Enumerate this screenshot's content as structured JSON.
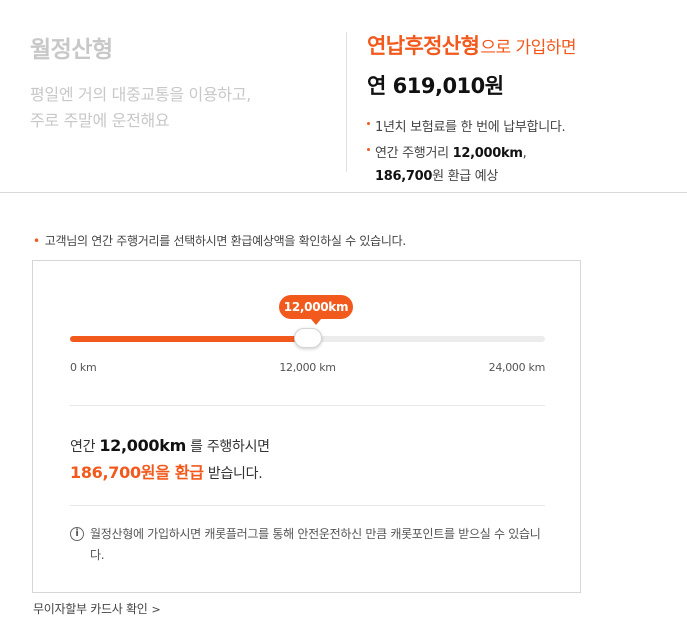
{
  "plan_left": {
    "name": "월정산형",
    "desc_line1": "평일엔 거의 대중교통을 이용하고,",
    "desc_line2": "주로 주말에 운전해요"
  },
  "plan_right": {
    "headline_emph": "연납후정산형",
    "headline_suffix": "으로 가입하면",
    "price": "연 619,010원",
    "bullet1": "1년치 보험료를 한 번에 납부합니다.",
    "bullet2_pre": "연간 주행거리 ",
    "bullet2_km": "12,000km",
    "bullet2_post": ",",
    "bullet2_refund": "186,700",
    "bullet2_tail": "원 환급 예상"
  },
  "notice": {
    "text": "고객님의 연간 주행거리를 선택하시면 환급예상액을 확인하실 수 있습니다."
  },
  "slider": {
    "bubble": "12,000km",
    "min_label": "0 km",
    "mid_label": "12,000 km",
    "max_label": "24,000 km",
    "min": 0,
    "max": 24000,
    "value": 12000
  },
  "result": {
    "pre": "연간 ",
    "km": "12,000km",
    "mid": " 를 주행하시면",
    "refund": "186,700원을 환급",
    "tail": " 받습니다."
  },
  "info": {
    "icon": "i",
    "text": "월정산형에 가입하시면 캐롯플러그를 통해 안전운전하신 만큼 캐롯포인트를 받으실 수 있습니다."
  },
  "link": {
    "label": "무이자할부 카드사 확인",
    "chevron": ">"
  },
  "colors": {
    "accent": "#f25a1d",
    "muted": "#c8c8c8"
  }
}
